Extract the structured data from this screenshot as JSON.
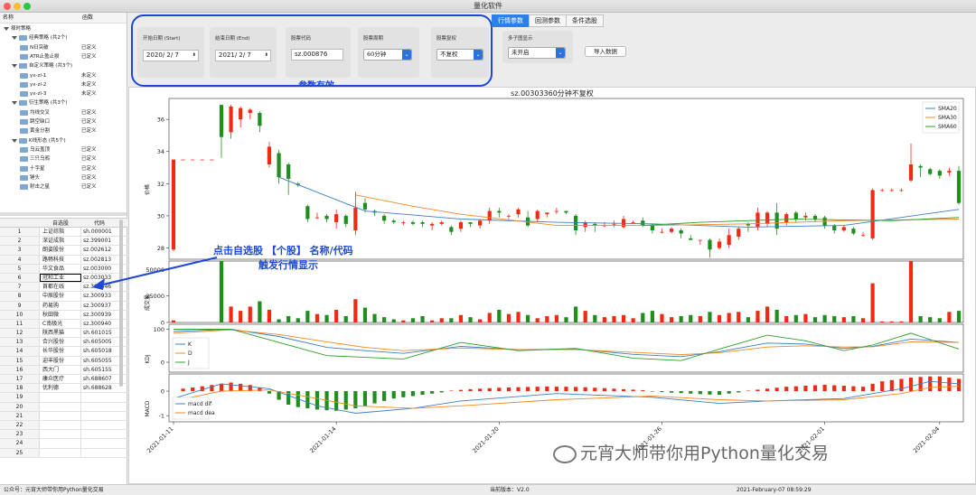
{
  "window": {
    "title": "量化软件"
  },
  "left": {
    "tree_headers": [
      "名称",
      "函数"
    ],
    "tree": [
      {
        "level": 0,
        "label": "择时策略",
        "status": "",
        "toggle": false,
        "folder": false
      },
      {
        "level": 1,
        "label": "经典策略 (共2个)",
        "status": "",
        "toggle": true,
        "folder": true
      },
      {
        "level": 2,
        "label": "N日突破",
        "status": "已定义",
        "toggle": false,
        "folder": true
      },
      {
        "level": 2,
        "label": "ATR止盈止损",
        "status": "已定义",
        "toggle": false,
        "folder": true
      },
      {
        "level": 1,
        "label": "自定义策略 (共3个)",
        "status": "",
        "toggle": true,
        "folder": true
      },
      {
        "level": 2,
        "label": "yx-zl-1",
        "status": "未定义",
        "toggle": false,
        "folder": true
      },
      {
        "level": 2,
        "label": "yx-zl-2",
        "status": "未定义",
        "toggle": false,
        "folder": true
      },
      {
        "level": 2,
        "label": "yx-zl-3",
        "status": "未定义",
        "toggle": false,
        "folder": true
      },
      {
        "level": 1,
        "label": "衍生策略 (共3个)",
        "status": "",
        "toggle": true,
        "folder": true
      },
      {
        "level": 2,
        "label": "均线交叉",
        "status": "已定义",
        "toggle": false,
        "folder": true
      },
      {
        "level": 2,
        "label": "跳空缺口",
        "status": "已定义",
        "toggle": false,
        "folder": true
      },
      {
        "level": 2,
        "label": "黄金分割",
        "status": "已定义",
        "toggle": false,
        "folder": true
      },
      {
        "level": 1,
        "label": "K线形态 (共5个)",
        "status": "",
        "toggle": true,
        "folder": true
      },
      {
        "level": 2,
        "label": "乌云盖顶",
        "status": "已定义",
        "toggle": false,
        "folder": true
      },
      {
        "level": 2,
        "label": "三只乌鸦",
        "status": "已定义",
        "toggle": false,
        "folder": true
      },
      {
        "level": 2,
        "label": "十字星",
        "status": "已定义",
        "toggle": false,
        "folder": true
      },
      {
        "level": 2,
        "label": "锤头",
        "status": "已定义",
        "toggle": false,
        "folder": true
      },
      {
        "level": 2,
        "label": "射击之星",
        "status": "已定义",
        "toggle": false,
        "folder": true
      }
    ],
    "table_headers": [
      "",
      "自选股",
      "代码"
    ],
    "stocks": [
      [
        "1",
        "上证综指",
        "sh.000001"
      ],
      [
        "2",
        "深证成指",
        "sz.399001"
      ],
      [
        "3",
        "朗姿股份",
        "sz.002612"
      ],
      [
        "4",
        "路畅科技",
        "sz.002813"
      ],
      [
        "5",
        "华文食品",
        "sz.003000"
      ],
      [
        "6",
        "冠和工业",
        "sz.003033"
      ],
      [
        "7",
        "首都在线",
        "sz.300846"
      ],
      [
        "8",
        "中辰股份",
        "sz.300933"
      ],
      [
        "9",
        "药易购",
        "sz.300937"
      ],
      [
        "10",
        "秋田微",
        "sz.300939"
      ],
      [
        "11",
        "C南极光",
        "sz.300940"
      ],
      [
        "12",
        "陕西黑猫",
        "sh.601015"
      ],
      [
        "13",
        "合兴股份",
        "sh.605005"
      ],
      [
        "14",
        "长华股份",
        "sh.605018"
      ],
      [
        "15",
        "迎丰股份",
        "sh.605055"
      ],
      [
        "16",
        "西大门",
        "sh.605155"
      ],
      [
        "17",
        "康众医疗",
        "sh.688607"
      ],
      [
        "18",
        "优利德",
        "sh.688628"
      ],
      [
        "19",
        "",
        ""
      ],
      [
        "20",
        "",
        ""
      ],
      [
        "21",
        "",
        ""
      ],
      [
        "22",
        "",
        ""
      ],
      [
        "23",
        "",
        ""
      ],
      [
        "24",
        "",
        ""
      ],
      [
        "25",
        "",
        ""
      ]
    ]
  },
  "params": {
    "start_label": "开始日期 (Start)",
    "start_value": "2020/ 2/ 7",
    "end_label": "结束日期 (End)",
    "end_value": "2021/ 2/ 7",
    "code_label": "股票代码",
    "code_value": "sz.000876",
    "period_label": "股票周期",
    "period_value": "60分钟",
    "adjust_label": "股票复权",
    "adjust_value": "不复权",
    "multi_label": "多子图显示",
    "multi_value": "未开启",
    "import_button": "导入数据"
  },
  "tabs": [
    "行情参数",
    "回测参数",
    "条件选股"
  ],
  "annotations": {
    "params_valid": "参数有效",
    "click_hint_line1": "点击自选股 【个股】 名称/代码",
    "click_hint_line2": "触发行情显示"
  },
  "watermark": "元宵大师带你用Python量化交易",
  "status": {
    "left": "公众号：元宵大师带你用Python量化交易",
    "mid": "当前版本：V2.0",
    "right": "2021-February-07 08:59:29"
  },
  "colors": {
    "up": "#ef2b14",
    "down": "#1f8e1f",
    "sma20": "#3b7fc4",
    "sma30": "#f08a24",
    "sma60": "#2ca02c",
    "accent": "#2f7fe8",
    "annotation": "#1e48d8"
  },
  "chart_data": {
    "type": "candlestick",
    "title": "sz.00303360分钟不复权",
    "price_ylabel": "价格",
    "volume_ylabel": "成交量",
    "kdj_ylabel": "KDJ",
    "macd_ylabel": "MACD",
    "price_yticks": [
      28,
      30,
      32,
      34,
      36
    ],
    "volume_yticks": [
      0,
      25000,
      50000
    ],
    "kdj_yticks": [
      0,
      100
    ],
    "macd_yticks": [
      -1,
      0
    ],
    "x_ticks": [
      "2021-01-11",
      "2021-01-14",
      "2021-01-20",
      "2021-01-26",
      "2021-02-01",
      "2021-02-04"
    ],
    "legend_price": [
      "SMA20",
      "SMA30",
      "SMA60"
    ],
    "legend_kdj": [
      "K",
      "D",
      "J"
    ],
    "legend_macd": [
      "macd dif",
      "macd dea"
    ],
    "ohlc": [
      [
        27.9,
        33.5,
        27.8,
        33.5
      ],
      [
        33.5,
        33.5,
        33.5,
        33.5
      ],
      [
        33.5,
        33.5,
        33.5,
        33.5
      ],
      [
        33.5,
        33.5,
        33.5,
        33.5
      ],
      [
        33.5,
        33.5,
        33.5,
        33.5
      ],
      [
        36.9,
        34.9,
        33.6,
        36.9
      ],
      [
        35.2,
        36.8,
        34.8,
        36.9
      ],
      [
        36.0,
        36.7,
        35.5,
        36.8
      ],
      [
        36.4,
        36.6,
        36.0,
        36.7
      ],
      [
        36.4,
        35.6,
        35.2,
        36.5
      ],
      [
        33.2,
        34.3,
        33.0,
        34.6
      ],
      [
        33.9,
        32.4,
        32.0,
        34.1
      ],
      [
        33.2,
        32.3,
        31.3,
        33.3
      ],
      [
        32.0,
        31.9,
        31.8,
        32.1
      ],
      [
        30.6,
        29.8,
        29.6,
        30.7
      ],
      [
        29.9,
        29.9,
        29.8,
        30.2
      ],
      [
        30.0,
        29.8,
        29.6,
        30.1
      ],
      [
        29.6,
        30.1,
        29.2,
        30.4
      ],
      [
        30.0,
        29.5,
        29.3,
        30.1
      ],
      [
        29.1,
        30.5,
        28.8,
        31.5
      ],
      [
        30.8,
        30.4,
        30.2,
        31.1
      ],
      [
        30.3,
        30.2,
        30.0,
        30.4
      ],
      [
        30.0,
        29.7,
        29.5,
        30.1
      ],
      [
        29.7,
        29.6,
        29.5,
        29.8
      ],
      [
        29.6,
        29.6,
        29.4,
        29.7
      ],
      [
        29.6,
        29.5,
        29.4,
        29.7
      ],
      [
        29.6,
        29.5,
        29.3,
        29.7
      ],
      [
        29.4,
        29.5,
        29.1,
        29.6
      ],
      [
        29.5,
        29.6,
        29.4,
        29.7
      ],
      [
        29.3,
        29.0,
        28.8,
        29.4
      ],
      [
        29.2,
        29.6,
        29.0,
        29.7
      ],
      [
        29.6,
        29.5,
        29.3,
        29.6
      ],
      [
        29.4,
        29.7,
        29.2,
        29.8
      ],
      [
        29.7,
        30.3,
        29.5,
        30.5
      ],
      [
        30.3,
        30.2,
        29.9,
        30.5
      ],
      [
        30.0,
        30.0,
        29.8,
        30.1
      ],
      [
        30.1,
        30.4,
        29.9,
        30.5
      ],
      [
        29.9,
        29.4,
        29.3,
        30.3
      ],
      [
        29.8,
        30.3,
        29.6,
        30.4
      ],
      [
        30.1,
        30.2,
        29.9,
        30.2
      ],
      [
        30.3,
        30.3,
        30.1,
        30.5
      ],
      [
        30.3,
        30.2,
        30.1,
        30.3
      ],
      [
        30.0,
        29.1,
        28.8,
        30.1
      ],
      [
        29.3,
        29.6,
        29.0,
        29.7
      ],
      [
        29.5,
        29.4,
        29.0,
        29.6
      ],
      [
        29.4,
        29.4,
        29.3,
        29.6
      ],
      [
        29.5,
        29.5,
        29.3,
        29.7
      ],
      [
        29.3,
        29.8,
        29.2,
        30.0
      ],
      [
        29.6,
        29.6,
        29.5,
        29.7
      ],
      [
        29.7,
        29.4,
        29.3,
        29.9
      ],
      [
        29.4,
        29.1,
        28.9,
        29.5
      ],
      [
        29.0,
        29.0,
        28.9,
        29.2
      ],
      [
        29.0,
        29.2,
        28.9,
        29.3
      ],
      [
        29.1,
        28.9,
        28.6,
        29.2
      ],
      [
        28.6,
        28.5,
        28.5,
        28.8
      ],
      [
        28.5,
        28.5,
        28.2,
        28.5
      ],
      [
        28.5,
        27.9,
        27.4,
        28.6
      ],
      [
        28.0,
        28.4,
        27.9,
        28.6
      ],
      [
        28.2,
        28.8,
        28.0,
        29.2
      ],
      [
        28.7,
        29.2,
        28.5,
        29.3
      ],
      [
        29.5,
        29.4,
        29.0,
        29.6
      ],
      [
        29.3,
        30.2,
        29.1,
        30.5
      ],
      [
        29.5,
        30.2,
        29.3,
        30.3
      ],
      [
        30.2,
        29.2,
        28.8,
        30.8
      ],
      [
        29.6,
        30.1,
        29.4,
        30.2
      ],
      [
        30.2,
        29.8,
        29.6,
        30.3
      ],
      [
        29.9,
        30.0,
        29.7,
        30.2
      ],
      [
        30.0,
        29.8,
        29.6,
        30.1
      ],
      [
        29.9,
        29.4,
        29.2,
        30.0
      ],
      [
        29.4,
        29.1,
        28.9,
        29.5
      ],
      [
        29.1,
        29.3,
        29.0,
        29.4
      ],
      [
        29.2,
        28.9,
        28.8,
        29.3
      ],
      [
        28.8,
        28.8,
        28.7,
        29.0
      ],
      [
        28.6,
        31.6,
        28.5,
        31.7
      ],
      [
        31.6,
        31.6,
        31.5,
        31.7
      ],
      [
        31.6,
        31.6,
        31.5,
        31.7
      ],
      [
        31.6,
        31.6,
        31.5,
        31.7
      ],
      [
        32.2,
        33.2,
        32.1,
        34.5
      ],
      [
        33.1,
        33.0,
        32.4,
        33.2
      ],
      [
        32.9,
        32.6,
        32.5,
        33.0
      ],
      [
        32.8,
        32.5,
        32.3,
        32.9
      ],
      [
        32.7,
        32.8,
        32.5,
        33.0
      ],
      [
        32.8,
        30.8,
        30.7,
        33.1
      ]
    ],
    "volume": [
      2000,
      0,
      0,
      0,
      0,
      58000,
      15000,
      11000,
      15000,
      20000,
      12000,
      3000,
      6000,
      4000,
      11000,
      8000,
      7000,
      12000,
      6000,
      22000,
      14000,
      8000,
      5000,
      3000,
      2000,
      4000,
      6000,
      2000,
      4000,
      4000,
      7000,
      5000,
      3000,
      9000,
      12000,
      8000,
      10000,
      7000,
      4000,
      6000,
      7000,
      5000,
      15000,
      11000,
      7000,
      5000,
      6000,
      7000,
      4000,
      9000,
      11000,
      8000,
      5000,
      6000,
      7000,
      6000,
      10000,
      7000,
      9000,
      10000,
      5000,
      11000,
      15000,
      12000,
      6000,
      7000,
      8000,
      5000,
      7000,
      6000,
      5000,
      6000,
      4000,
      37000,
      1000,
      1000,
      1000,
      58000,
      6000,
      5000,
      4000,
      10000,
      11000
    ],
    "sma20": [
      [
        11,
        32.4
      ],
      [
        20,
        30.3
      ],
      [
        30,
        29.8
      ],
      [
        40,
        29.6
      ],
      [
        50,
        29.5
      ],
      [
        60,
        29.3
      ],
      [
        70,
        29.4
      ],
      [
        76,
        29.9
      ],
      [
        82,
        30.4
      ]
    ],
    "sma30": [
      [
        19,
        31.3
      ],
      [
        25,
        30.6
      ],
      [
        30,
        30.1
      ],
      [
        40,
        29.4
      ],
      [
        50,
        29.4
      ],
      [
        60,
        29.5
      ],
      [
        70,
        29.7
      ],
      [
        82,
        29.8
      ]
    ],
    "sma60": [
      [
        49,
        29.4
      ],
      [
        55,
        29.6
      ],
      [
        65,
        29.8
      ],
      [
        75,
        29.7
      ],
      [
        82,
        29.9
      ]
    ],
    "kdj_k": [
      [
        0,
        93
      ],
      [
        6,
        100
      ],
      [
        11,
        78
      ],
      [
        16,
        45
      ],
      [
        20,
        35
      ],
      [
        24,
        27
      ],
      [
        30,
        48
      ],
      [
        36,
        38
      ],
      [
        42,
        40
      ],
      [
        48,
        24
      ],
      [
        53,
        17
      ],
      [
        57,
        32
      ],
      [
        62,
        58
      ],
      [
        66,
        55
      ],
      [
        70,
        42
      ],
      [
        73,
        48
      ],
      [
        77,
        70
      ],
      [
        82,
        60
      ]
    ],
    "kdj_d": [
      [
        0,
        88
      ],
      [
        6,
        98
      ],
      [
        11,
        84
      ],
      [
        16,
        62
      ],
      [
        20,
        45
      ],
      [
        24,
        35
      ],
      [
        30,
        43
      ],
      [
        36,
        38
      ],
      [
        42,
        38
      ],
      [
        48,
        30
      ],
      [
        53,
        23
      ],
      [
        57,
        29
      ],
      [
        62,
        46
      ],
      [
        66,
        50
      ],
      [
        70,
        46
      ],
      [
        73,
        47
      ],
      [
        77,
        62
      ],
      [
        82,
        60
      ]
    ],
    "kdj_j": [
      [
        0,
        100
      ],
      [
        6,
        100
      ],
      [
        11,
        60
      ],
      [
        16,
        20
      ],
      [
        20,
        15
      ],
      [
        24,
        10
      ],
      [
        30,
        60
      ],
      [
        36,
        35
      ],
      [
        42,
        42
      ],
      [
        48,
        12
      ],
      [
        53,
        5
      ],
      [
        57,
        40
      ],
      [
        62,
        82
      ],
      [
        66,
        65
      ],
      [
        70,
        35
      ],
      [
        73,
        52
      ],
      [
        77,
        88
      ],
      [
        82,
        40
      ]
    ],
    "macd_bar": [
      0,
      0.1,
      0.15,
      0.2,
      0.25,
      0.3,
      0.35,
      0.3,
      0.25,
      0.15,
      -0.1,
      -0.35,
      -0.55,
      -0.65,
      -0.7,
      -0.75,
      -0.78,
      -0.8,
      -0.75,
      -0.7,
      -0.6,
      -0.5,
      -0.4,
      -0.3,
      -0.25,
      -0.2,
      -0.15,
      -0.1,
      -0.05,
      0.02,
      0.05,
      0.08,
      0.1,
      0.12,
      0.14,
      0.15,
      0.16,
      0.17,
      0.18,
      0.19,
      0.18,
      0.18,
      0.17,
      0.16,
      0.14,
      0.12,
      0.1,
      0.08,
      0.06,
      0.04,
      -0.02,
      -0.04,
      -0.06,
      -0.08,
      -0.1,
      -0.12,
      -0.14,
      -0.15,
      -0.1,
      -0.05,
      0.02,
      0.06,
      0.1,
      0.14,
      0.18,
      0.2,
      0.22,
      0.24,
      0.26,
      0.24,
      0.22,
      0.2,
      0.18,
      0.3,
      0.4,
      0.45,
      0.5,
      0.55,
      0.58,
      0.6,
      0.6,
      0.55,
      0.5
    ],
    "macd_dif": [
      [
        0,
        -0.3
      ],
      [
        5,
        0.3
      ],
      [
        10,
        0.1
      ],
      [
        15,
        -0.6
      ],
      [
        19,
        -0.9
      ],
      [
        25,
        -0.7
      ],
      [
        30,
        -0.4
      ],
      [
        40,
        -0.1
      ],
      [
        50,
        -0.25
      ],
      [
        57,
        -0.5
      ],
      [
        62,
        -0.4
      ],
      [
        70,
        -0.3
      ],
      [
        76,
        0.1
      ],
      [
        79,
        0.4
      ],
      [
        82,
        0.3
      ]
    ],
    "macd_dea": [
      [
        0,
        -0.4
      ],
      [
        5,
        0.0
      ],
      [
        10,
        0.05
      ],
      [
        15,
        -0.3
      ],
      [
        19,
        -0.6
      ],
      [
        25,
        -0.7
      ],
      [
        30,
        -0.6
      ],
      [
        40,
        -0.35
      ],
      [
        50,
        -0.2
      ],
      [
        57,
        -0.35
      ],
      [
        62,
        -0.4
      ],
      [
        70,
        -0.35
      ],
      [
        76,
        -0.1
      ],
      [
        79,
        0.15
      ],
      [
        82,
        0.2
      ]
    ]
  }
}
